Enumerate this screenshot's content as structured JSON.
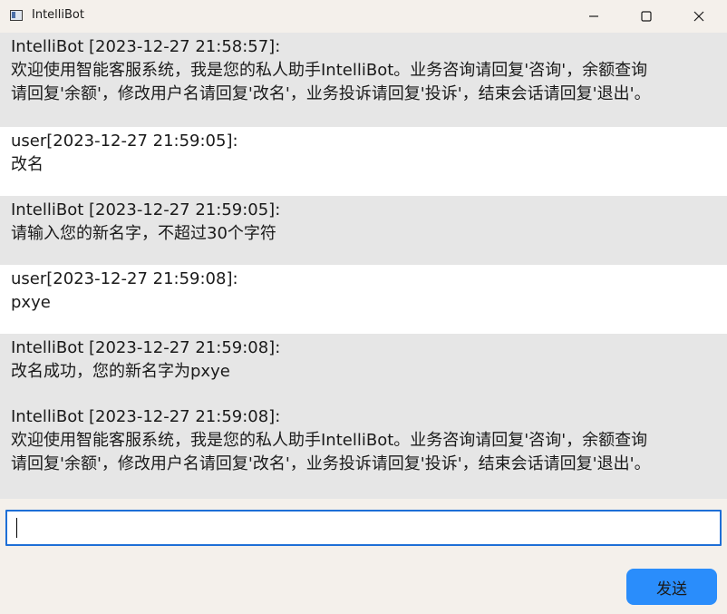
{
  "window": {
    "title": "IntelliBot",
    "icon": "app-window-icon",
    "controls": [
      "minimize-icon",
      "maximize-icon",
      "close-icon"
    ]
  },
  "messages": [
    {
      "sender": "bot",
      "header": "IntelliBot [2023-12-27 21:58:57]:",
      "text": "欢迎使用智能客服系统，我是您的私人助手IntelliBot。业务咨询请回复'咨询'，余额查询\n请回复'余额'，修改用户名请回复'改名'，业务投诉请回复'投诉'，结束会话请回复'退出'。"
    },
    {
      "sender": "user",
      "header": "user[2023-12-27 21:59:05]:",
      "text": "改名"
    },
    {
      "sender": "bot",
      "header": "IntelliBot [2023-12-27 21:59:05]:",
      "text": "请输入您的新名字，不超过30个字符"
    },
    {
      "sender": "user",
      "header": "user[2023-12-27 21:59:08]:",
      "text": "pxye"
    },
    {
      "sender": "bot",
      "header": "IntelliBot [2023-12-27 21:59:08]:",
      "text": "改名成功，您的新名字为pxye"
    },
    {
      "sender": "bot",
      "header": "IntelliBot [2023-12-27 21:59:08]:",
      "text": "欢迎使用智能客服系统，我是您的私人助手IntelliBot。业务咨询请回复'咨询'，余额查询\n请回复'余额'，修改用户名请回复'改名'，业务投诉请回复'投诉'，结束会话请回复'退出'。"
    }
  ],
  "input": {
    "value": "",
    "placeholder": ""
  },
  "send_button": {
    "label": "发送"
  },
  "colors": {
    "bot_bg": "#e6e6e6",
    "user_bg": "#ffffff",
    "accent": "#2a8dfb",
    "input_border": "#1e6fd6"
  }
}
